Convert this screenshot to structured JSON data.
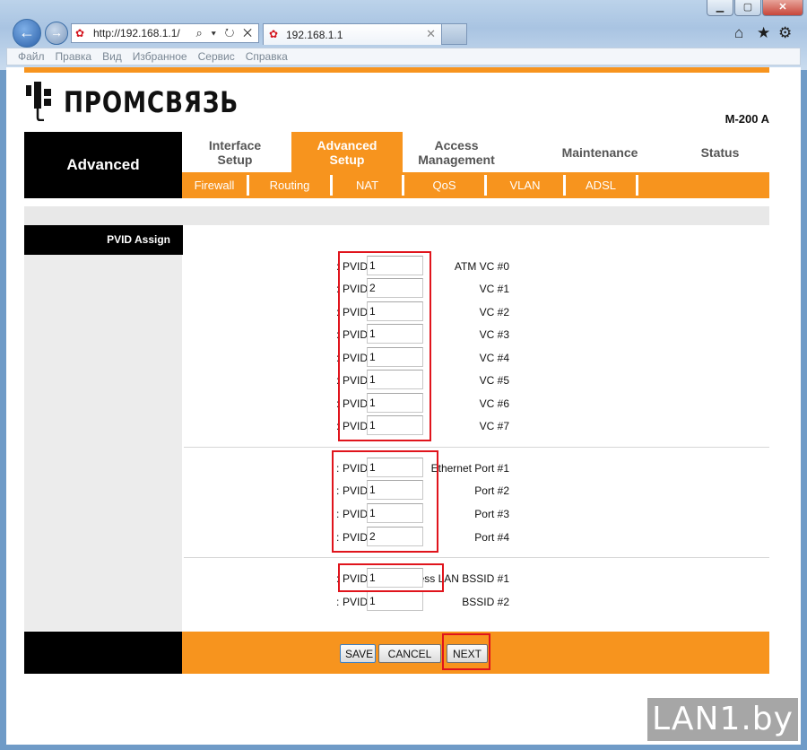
{
  "browser": {
    "window_buttons": [
      "▁",
      "▢",
      "✕"
    ],
    "address": "http://192.168.1.1/",
    "address_tools": "⌕ ▾ ↻ ✕",
    "tab_title": "192.168.1.1",
    "tab_close": "✕",
    "home_icon": "⌂",
    "favorites_icon": "★",
    "settings_icon": "⚙",
    "menu": [
      "Файл",
      "Правка",
      "Вид",
      "Избранное",
      "Сервис",
      "Справка"
    ]
  },
  "header": {
    "logo_text": "ПРОМСВЯЗЬ",
    "model": "M-200 A"
  },
  "nav": {
    "section": "Advanced",
    "tabs": [
      {
        "line1": "Interface",
        "line2": "Setup"
      },
      {
        "line1": "Advanced",
        "line2": "Setup"
      },
      {
        "line1": "Access",
        "line2": "Management"
      },
      {
        "line1": "Maintenance",
        "line2": ""
      },
      {
        "line1": "Status",
        "line2": ""
      }
    ],
    "subtabs": [
      "Firewall",
      "Routing",
      "NAT",
      "QoS",
      "VLAN",
      "ADSL"
    ]
  },
  "panel": {
    "title": "PVID Assign"
  },
  "pvid_label": "PVID",
  "colon": ":",
  "atm": [
    {
      "label": "ATM VC #0",
      "value": "1"
    },
    {
      "label": "VC #1",
      "value": "2"
    },
    {
      "label": "VC #2",
      "value": "1"
    },
    {
      "label": "VC #3",
      "value": "1"
    },
    {
      "label": "VC #4",
      "value": "1"
    },
    {
      "label": "VC #5",
      "value": "1"
    },
    {
      "label": "VC #6",
      "value": "1"
    },
    {
      "label": "VC #7",
      "value": "1"
    }
  ],
  "ethernet": [
    {
      "label": "Ethernet Port #1",
      "value": "1"
    },
    {
      "label": "Port #2",
      "value": "1"
    },
    {
      "label": "Port #3",
      "value": "1"
    },
    {
      "label": "Port #4",
      "value": "2"
    }
  ],
  "wireless": [
    {
      "label": "Wireless LAN BSSID #1",
      "value": "1"
    },
    {
      "label": "BSSID #2",
      "value": "1"
    }
  ],
  "buttons": {
    "save": "SAVE",
    "cancel": "CANCEL",
    "next": "NEXT"
  },
  "watermark": "LAN1.by",
  "colors": {
    "accent": "#f7941e",
    "highlight": "#e0141c"
  }
}
